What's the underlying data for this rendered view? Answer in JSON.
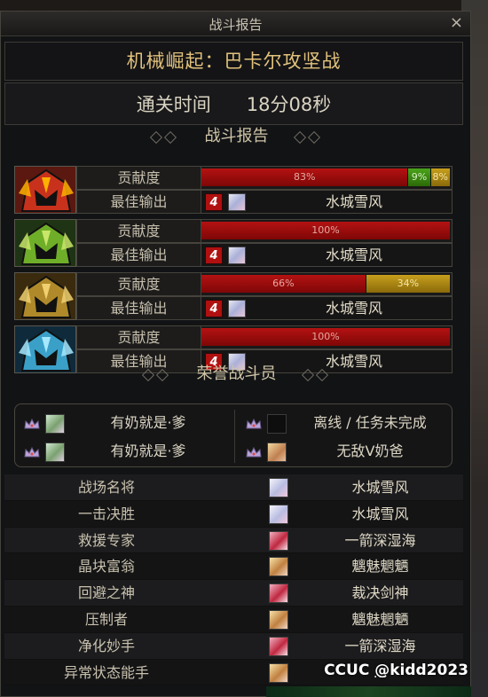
{
  "window": {
    "title": "战斗报告",
    "close_label": "×"
  },
  "dungeon_title": "机械崛起：巴卡尔攻坚战",
  "clear_time": {
    "label": "通关时间",
    "value": "18分08秒"
  },
  "report_header": "战斗报告",
  "row_labels": {
    "contribution": "贡献度",
    "best_output": "最佳输出"
  },
  "teams": [
    {
      "portrait_icon": "red-flame-helm-icon",
      "segments": [
        {
          "label": "83%",
          "value": 83,
          "color": "red"
        },
        {
          "label": "9%",
          "value": 9,
          "color": "green"
        },
        {
          "label": "8%",
          "value": 8,
          "color": "gold"
        }
      ],
      "best_icon_text": "4",
      "best_player": "水城雪风"
    },
    {
      "portrait_icon": "green-horned-helm-icon",
      "segments": [
        {
          "label": "100%",
          "value": 100,
          "color": "red"
        }
      ],
      "best_icon_text": "4",
      "best_player": "水城雪风"
    },
    {
      "portrait_icon": "gold-horned-helm-icon",
      "segments": [
        {
          "label": "66%",
          "value": 66,
          "color": "red"
        },
        {
          "label": "34%",
          "value": 34,
          "color": "gold"
        }
      ],
      "best_icon_text": "4",
      "best_player": "水城雪风"
    },
    {
      "portrait_icon": "blue-ice-helm-icon",
      "segments": [
        {
          "label": "100%",
          "value": 100,
          "color": "red"
        }
      ],
      "best_icon_text": "4",
      "best_player": "水城雪风"
    }
  ],
  "honor_header": "荣誉战斗员",
  "honor_players": [
    {
      "name": "有奶就是·爹",
      "status": "online"
    },
    {
      "name": "离线 / 任务未完成",
      "status": "offline"
    },
    {
      "name": "有奶就是·爹",
      "status": "online"
    },
    {
      "name": "无敌V奶爸",
      "status": "online"
    }
  ],
  "awards": [
    {
      "title": "战场名将",
      "player": "水城雪风",
      "avatar": "white-hair"
    },
    {
      "title": "一击决胜",
      "player": "水城雪风",
      "avatar": "white-hair"
    },
    {
      "title": "救援专家",
      "player": "一箭深湿海",
      "avatar": "red-hair"
    },
    {
      "title": "晶块富翁",
      "player": "魑魅魍魉",
      "avatar": "blonde-hair"
    },
    {
      "title": "回避之神",
      "player": "裁决剑神",
      "avatar": "red-hair"
    },
    {
      "title": "压制者",
      "player": "魑魅魍魉",
      "avatar": "blonde-hair"
    },
    {
      "title": "净化妙手",
      "player": "一箭深湿海",
      "avatar": "red-hair"
    },
    {
      "title": "异常状态能手",
      "player": "…",
      "avatar": "blonde-hair"
    }
  ],
  "watermark": "CCUC @kidd2023",
  "colors": {
    "bar_red": "#b41212",
    "bar_green": "#4aa31a",
    "bar_gold": "#c79f1c",
    "title_gold": "#e2c27c"
  }
}
